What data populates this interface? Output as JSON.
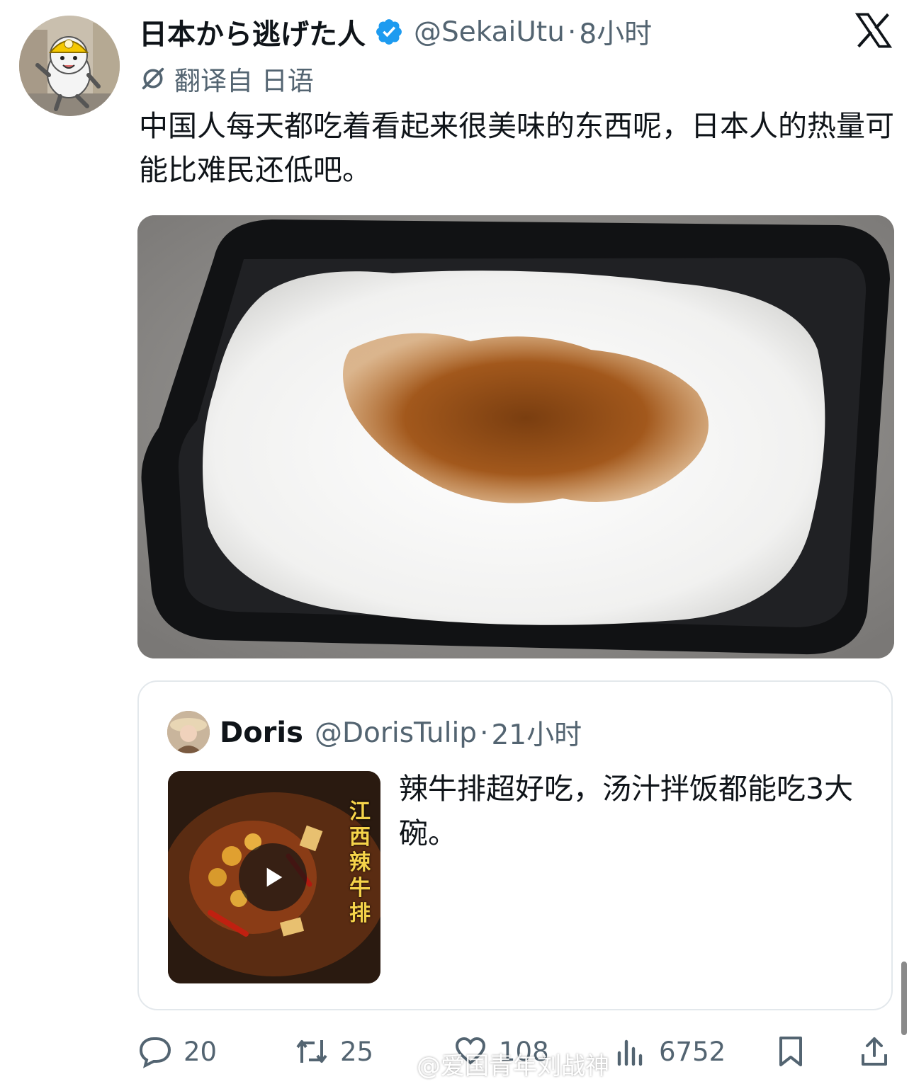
{
  "tweet": {
    "display_name": "日本から逃げた人",
    "handle": "@SekaiUtu",
    "separator": "·",
    "time": "8小时",
    "translated_label": "翻译自 日语",
    "text": "中国人每天都吃着看起来很美味的东西呢，日本人的热量可能比难民还低吧。",
    "avatar_icon": "construction-cat-avatar",
    "verified_icon": "verified-badge-icon",
    "brand_icon": "x-logo-icon",
    "media_icon": "rice-box-photo"
  },
  "quote": {
    "display_name": "Doris",
    "handle": "@DorisTulip",
    "separator": "·",
    "time": "21小时",
    "text": "辣牛排超好吃，汤汁拌饭都能吃3大碗。",
    "thumbnail_caption": "江西辣牛排",
    "thumbnail_icon": "video-thumbnail"
  },
  "actions": {
    "reply_count": "20",
    "retweet_count": "25",
    "like_count": "108",
    "views_count": "6752"
  },
  "watermark": {
    "text": "@爱国青年刘战神"
  },
  "colors": {
    "primary_text": "#0f1419",
    "secondary_text": "#536471",
    "verified_blue": "#1d9bf0",
    "border": "#e3e8ec"
  }
}
